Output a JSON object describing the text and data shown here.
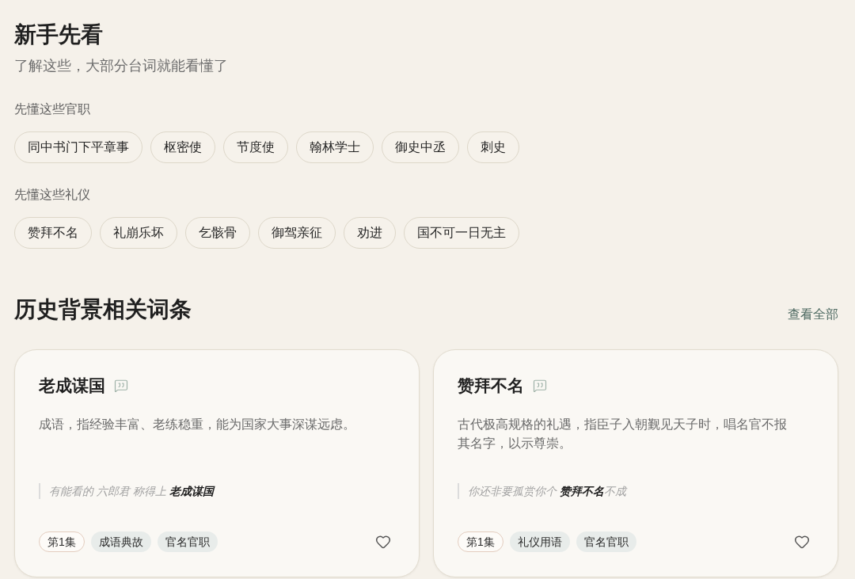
{
  "intro": {
    "title": "新手先看",
    "subtitle": "了解这些，大部分台词就能看懂了",
    "groups": [
      {
        "label": "先懂这些官职",
        "chips": [
          "同中书门下平章事",
          "枢密使",
          "节度使",
          "翰林学士",
          "御史中丞",
          "刺史"
        ]
      },
      {
        "label": "先懂这些礼仪",
        "chips": [
          "赞拜不名",
          "礼崩乐坏",
          "乞骸骨",
          "御驾亲征",
          "劝进",
          "国不可一日无主"
        ]
      }
    ]
  },
  "related": {
    "title": "历史背景相关词条",
    "view_all": "查看全部",
    "cards": [
      {
        "title": "老成谋国",
        "description": "成语，指经验丰富、老练稳重，能为国家大事深谋远虑。",
        "quote": "有能看的 六郎君 称得上 **老成谋国**",
        "tags": [
          {
            "kind": "episode",
            "label": "第1集"
          },
          {
            "kind": "category",
            "label": "成语典故"
          },
          {
            "kind": "category",
            "label": "官名官职"
          }
        ],
        "favorited": false
      },
      {
        "title": "赞拜不名",
        "description": "古代极高规格的礼遇，指臣子入朝觐见天子时，唱名官不报其名字，以示尊崇。",
        "quote": "你还非要孤赏你个 **赞拜不名**不成",
        "tags": [
          {
            "kind": "episode",
            "label": "第1集"
          },
          {
            "kind": "category",
            "label": "礼仪用语"
          },
          {
            "kind": "category",
            "label": "官名官职"
          }
        ],
        "favorited": false
      }
    ]
  }
}
